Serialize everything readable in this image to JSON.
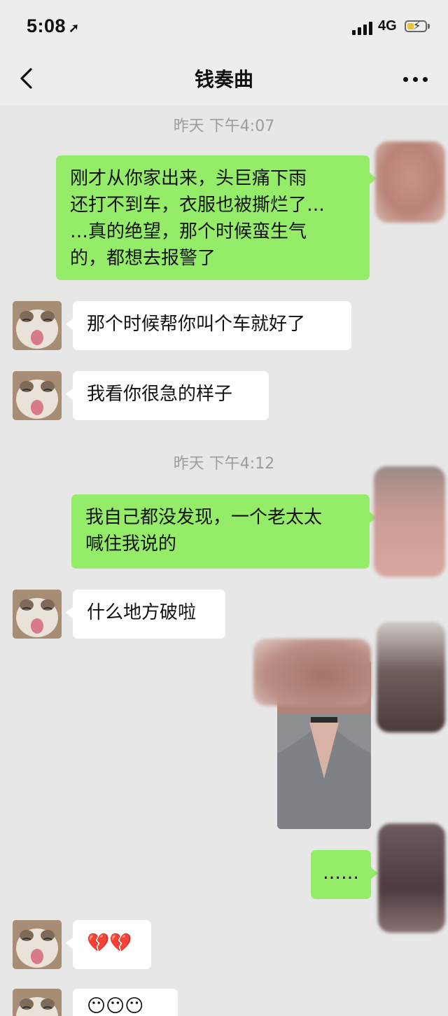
{
  "status": {
    "time": "5:08",
    "network": "4G"
  },
  "header": {
    "title": "钱奏曲"
  },
  "messages": [
    {
      "type": "timestamp",
      "text": "昨天 下午4:07"
    },
    {
      "type": "outgoing",
      "text": "刚才从你家出来，头巨痛下雨\n还打不到车，衣服也被撕烂了…\n…真的绝望，那个时候蛮生气\n的，都想去报警了"
    },
    {
      "type": "incoming",
      "text": "那个时候帮你叫个车就好了"
    },
    {
      "type": "incoming",
      "text": "我看你很急的样子"
    },
    {
      "type": "timestamp",
      "text": "昨天 下午4:12"
    },
    {
      "type": "outgoing",
      "text": "我自己都没发现，一个老太太\n喊住我说的"
    },
    {
      "type": "incoming",
      "text": "什么地方破啦"
    },
    {
      "type": "outgoing-image",
      "text": ""
    },
    {
      "type": "outgoing",
      "text": "……"
    },
    {
      "type": "incoming",
      "text": "💔💔"
    },
    {
      "type": "incoming",
      "text": "😶😶😶"
    }
  ],
  "colors": {
    "outgoing_bubble": "#95ec69",
    "incoming_bubble": "#ffffff",
    "chat_background": "#e7e7e7"
  },
  "icons": {
    "back": "chevron-left-icon",
    "more": "more-dots-icon",
    "signal": "signal-icon",
    "battery": "battery-charging-icon",
    "location": "location-arrow-icon"
  }
}
